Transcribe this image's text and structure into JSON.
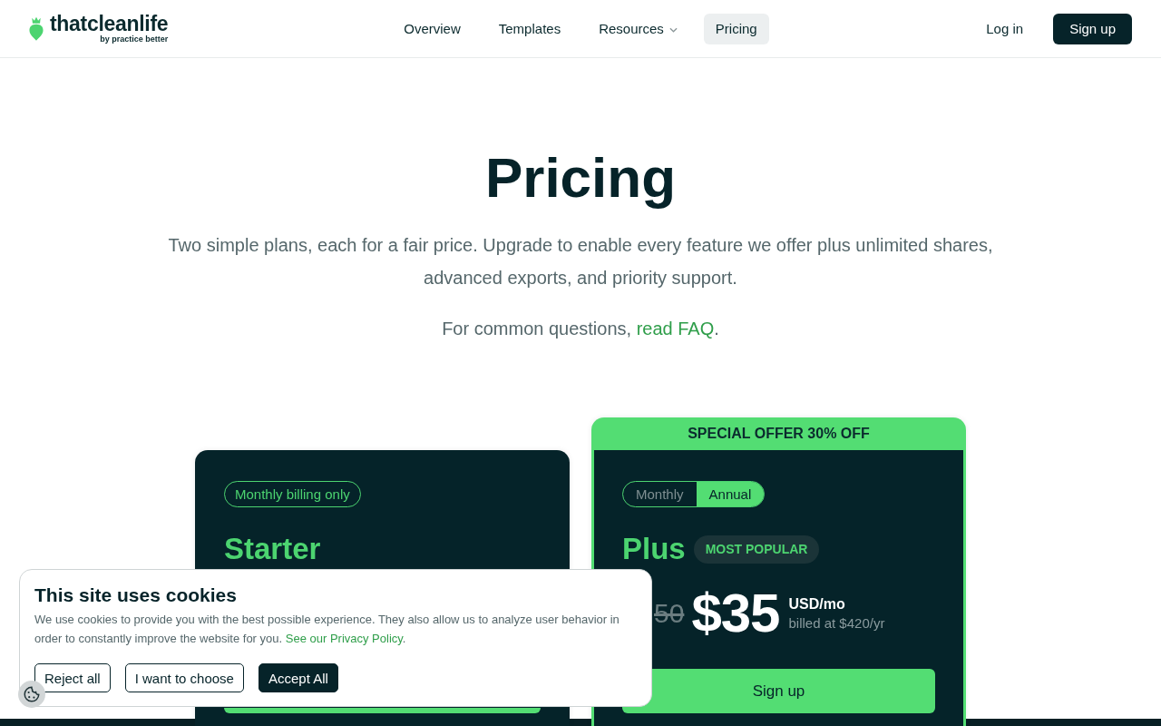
{
  "header": {
    "logo": {
      "wordmark": "thatcleanlife",
      "tagline": "by practice better"
    },
    "nav": [
      {
        "label": "Overview",
        "kind": "link",
        "selected": false
      },
      {
        "label": "Templates",
        "kind": "link",
        "selected": false
      },
      {
        "label": "Resources",
        "kind": "dropdown",
        "selected": false
      },
      {
        "label": "Pricing",
        "kind": "link",
        "selected": true
      }
    ],
    "login": "Log in",
    "signup": "Sign up"
  },
  "hero": {
    "title": "Pricing",
    "subtitle": "Two simple plans, each for a fair price. Upgrade to enable every feature we offer plus unlimited shares, advanced exports, and priority support.",
    "faq_prefix": "For common questions, ",
    "faq_link": "read FAQ",
    "faq_suffix": "."
  },
  "plans": [
    {
      "kind": "basic",
      "badge": "Monthly billing only",
      "name": "Starter"
    },
    {
      "kind": "featured",
      "offer": "SPECIAL OFFER 30% OFF",
      "billing_toggle": [
        {
          "label": "Monthly",
          "selected": false
        },
        {
          "label": "Annual",
          "selected": true
        }
      ],
      "name": "Plus",
      "tag": "MOST POPULAR",
      "old_price": "50",
      "price": "$35",
      "unit": "USD/mo",
      "billing_note": "billed at $420/yr",
      "button": "Sign up"
    }
  ],
  "cookie_banner": {
    "title": "This site uses cookies",
    "text": "We use cookies to provide you with the best possible experience. They also allow us to analyze user behavior in order to constantly improve the website for you. ",
    "link": "See our Privacy Policy",
    "suffix": ".",
    "buttons": [
      {
        "label": "Reject all",
        "kind": "outline"
      },
      {
        "label": "I want to choose",
        "kind": "outline"
      },
      {
        "label": "Accept All",
        "kind": "primary"
      }
    ]
  }
}
